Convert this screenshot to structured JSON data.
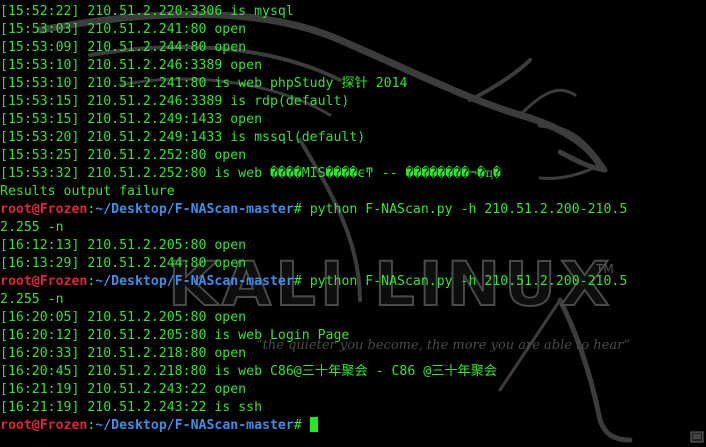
{
  "watermark": {
    "title": "KALI LINUX",
    "trademark": "TM",
    "tagline": "“the quieter you become, the more you are able to hear”"
  },
  "terminal": {
    "prompt": {
      "user_host": "root@Frozen",
      "separator": ":",
      "cwd": "~/Desktop/F-NAScan-master",
      "symbol": "# "
    },
    "lines": {
      "l0": "[15:52:22] 210.51.2.220:3306 is mysql",
      "l1": "[15:53:03] 210.51.2.241:80 open",
      "l2": "[15:53:09] 210.51.2.244:80 open",
      "l3": "[15:53:10] 210.51.2.246:3389 open",
      "l4": "[15:53:10] 210.51.2.241:80 is web phpStudy 探针 2014",
      "l5": "[15:53:15] 210.51.2.246:3389 is rdp(default)",
      "l6": "[15:53:15] 210.51.2.249:1433 open",
      "l7": "[15:53:20] 210.51.2.249:1433 is mssql(default)",
      "l8": "[15:53:25] 210.51.2.252:80 open",
      "l9": "[15:53:32] 210.51.2.252:80 is web ����MIS����ϵͳ -- ��������¬�ҵ�",
      "l10": "Results output failure",
      "cmd1": "python F-NAScan.py -h 210.51.2.200-210.5",
      "l12": "2.255 -n",
      "l13": "[16:12:13] 210.51.2.205:80 open",
      "l14": "[16:13:29] 210.51.2.244:80 open",
      "cmd2": "python F-NAScan.py -h 210.51.2.200-210.5",
      "l16": "2.255 -n",
      "l17": "[16:20:05] 210.51.2.205:80 open",
      "l18": "[16:20:12] 210.51.2.205:80 is web Login Page",
      "l19": "[16:20:33] 210.51.2.218:80 open",
      "l20": "[16:20:45] 210.51.2.218:80 is web C86@三十年聚会 - C86 @三十年聚会",
      "l21": "[16:21:19] 210.51.2.243:22 open",
      "l22": "[16:21:19] 210.51.2.243:22 is ssh"
    }
  },
  "colors": {
    "output_green": "#2ee62e",
    "prompt_red": "#e2233a",
    "path_blue": "#3b8eea",
    "background": "#000000"
  },
  "icons": {
    "watermark_logo": "kali-dragon-icon",
    "cursor": "block-cursor",
    "corner": "terminal-corner-icon"
  }
}
